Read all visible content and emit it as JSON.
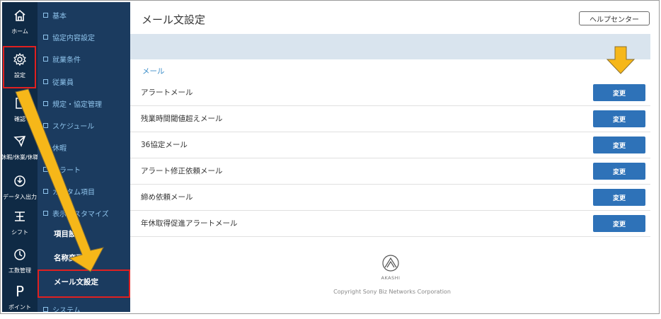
{
  "rail": {
    "items": [
      {
        "icon": "home-icon",
        "label": "ホーム"
      },
      {
        "icon": "gear-icon",
        "label": "設定"
      },
      {
        "icon": "document-icon",
        "label": "確認"
      },
      {
        "icon": "leaf-icon",
        "label": "休暇/休業/休職"
      },
      {
        "icon": "power-icon",
        "label": "データ入出力"
      },
      {
        "icon": "shift-icon",
        "label": "シフト"
      },
      {
        "icon": "clock-icon",
        "label": "工数管理"
      },
      {
        "icon": "point-icon",
        "glyph": "P",
        "label": "ポイント"
      }
    ]
  },
  "submenu": {
    "items": [
      "基本",
      "協定内容設定",
      "就業条件",
      "従業員",
      "規定・協定管理",
      "スケジュール",
      "休暇",
      "アラート",
      "カスタム項目",
      "表示カスタマイズ"
    ],
    "subitems": [
      "項目設定",
      "名称変更",
      "メール文設定"
    ],
    "last_item": "システム"
  },
  "page": {
    "title": "メール文設定",
    "help_button": "ヘルプセンター",
    "section_label": "メール",
    "rows": [
      {
        "label": "アラートメール",
        "button": "変更"
      },
      {
        "label": "残業時間閾値超えメール",
        "button": "変更"
      },
      {
        "label": "36協定メール",
        "button": "変更"
      },
      {
        "label": "アラート修正依頼メール",
        "button": "変更"
      },
      {
        "label": "締め依頼メール",
        "button": "変更"
      },
      {
        "label": "年休取得促進アラートメール",
        "button": "変更"
      }
    ]
  },
  "footer": {
    "logo_text": "AKASHI",
    "copyright": "Copyright Sony Biz Networks Corporation"
  },
  "colors": {
    "rail_bg": "#0f2a45",
    "submenu_bg": "#1b3b5f",
    "button_blue": "#2e72b8",
    "annotation_red": "#e02020",
    "annotation_arrow": "#f6b719"
  }
}
